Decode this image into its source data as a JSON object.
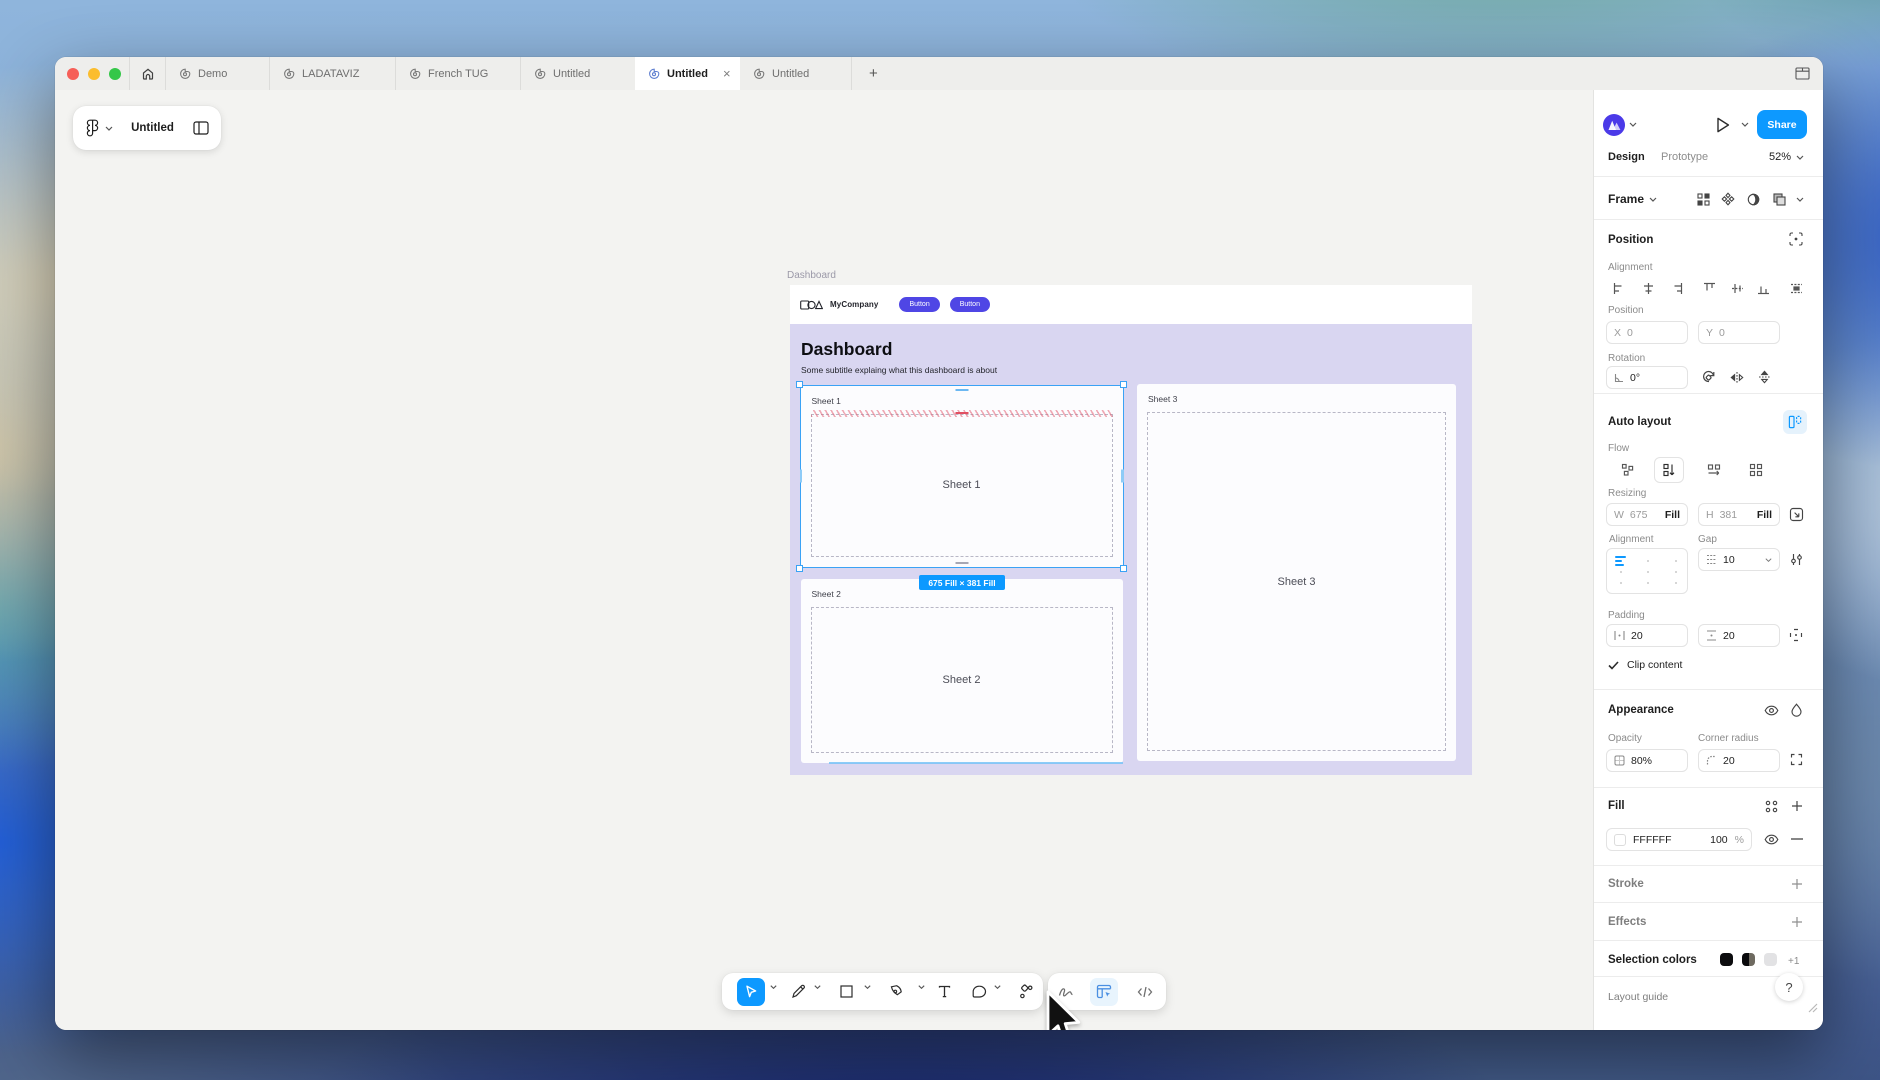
{
  "tabbar": {
    "tabs": [
      {
        "label": "Demo"
      },
      {
        "label": "LADATAVIZ"
      },
      {
        "label": "French TUG"
      },
      {
        "label": "Untitled"
      },
      {
        "label": "Untitled",
        "close": "×"
      },
      {
        "label": "Untitled"
      }
    ],
    "new_tab": "+"
  },
  "file_pill": {
    "name": "Untitled"
  },
  "canvas": {
    "frame_label": "Dashboard",
    "design": {
      "brand": "MyCompany",
      "buttons": [
        {
          "label": "Button"
        },
        {
          "label": "Button"
        }
      ],
      "title": "Dashboard",
      "subtitle": "Some subtitle explaing what this dashboard is about",
      "sheets": [
        {
          "label": "Sheet 1",
          "placeholder": "Sheet 1"
        },
        {
          "label": "Sheet 2",
          "placeholder": "Sheet 2"
        },
        {
          "label": "Sheet 3",
          "placeholder": "Sheet 3"
        }
      ]
    },
    "selection_badge": "675 Fill × 381 Fill"
  },
  "panel": {
    "share": "Share",
    "tabs": {
      "design": "Design",
      "prototype": "Prototype"
    },
    "zoom": "52%",
    "frame_row": {
      "type": "Frame"
    },
    "position": {
      "title": "Position",
      "alignment_label": "Alignment",
      "position_label": "Position",
      "x_label": "X",
      "x_value": "0",
      "y_label": "Y",
      "y_value": "0",
      "rotation_label": "Rotation",
      "rotation_value": "0°"
    },
    "auto_layout": {
      "title": "Auto layout",
      "flow_label": "Flow",
      "resizing_label": "Resizing",
      "w_label": "W",
      "w_value": "675",
      "w_mode": "Fill",
      "h_label": "H",
      "h_value": "381",
      "h_mode": "Fill",
      "alignment_label": "Alignment",
      "gap_label": "Gap",
      "gap_value": "10",
      "padding_label": "Padding",
      "padding_h": "20",
      "padding_v": "20",
      "clip_label": "Clip content"
    },
    "appearance": {
      "title": "Appearance",
      "opacity_label": "Opacity",
      "opacity_value": "80%",
      "radius_label": "Corner radius",
      "radius_value": "20"
    },
    "fill": {
      "title": "Fill",
      "hex": "FFFFFF",
      "opacity": "100",
      "percent": "%"
    },
    "stroke": {
      "title": "Stroke"
    },
    "effects": {
      "title": "Effects"
    },
    "selection_colors": {
      "title": "Selection colors",
      "more": "+1"
    },
    "layout_guide": {
      "title": "Layout guide"
    },
    "help": "?"
  },
  "colors": {
    "accent_blue": "#0d99ff",
    "indigo_button": "#4f46e5",
    "frame_body": "#d9d6f1",
    "selection": "#3aa2f5"
  }
}
